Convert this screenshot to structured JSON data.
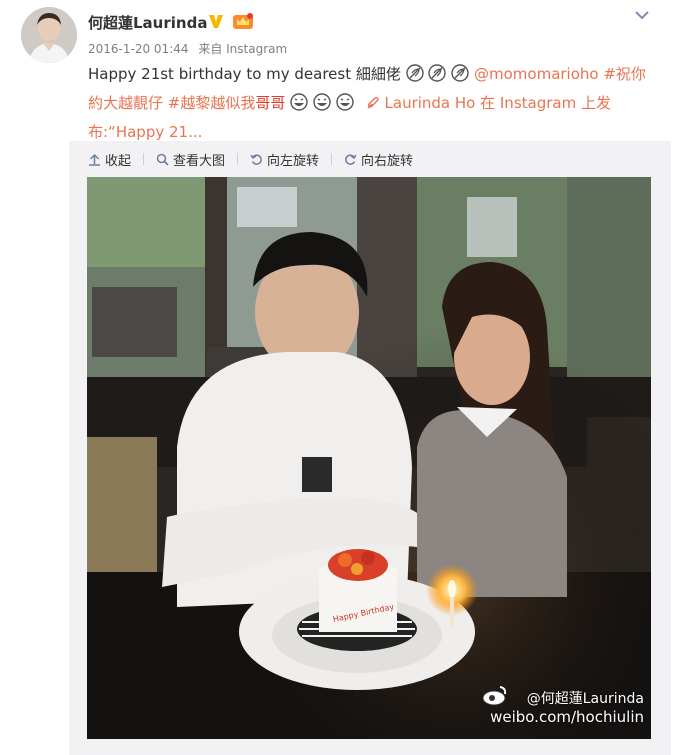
{
  "post": {
    "author": "何超蓮Laurinda",
    "timestamp": "2016-1-20 01:44",
    "source": "来自 Instagram",
    "text": {
      "intro": "Happy 21st birthday to my dearest 細細佬",
      "mention": "@momomarioho",
      "hashtag1": "#祝你約大越靚仔",
      "hashtag2": "#越黎越似我",
      "red_word": "哥哥",
      "link_label": "Laurinda Ho 在 Instagram 上发布:“Happy 21..."
    }
  },
  "toolbar": {
    "collapse": "收起",
    "view_large": "查看大图",
    "rotate_left": "向左旋转",
    "rotate_right": "向右旋转"
  },
  "photo": {
    "watermark_handle": "@何超蓮Laurinda",
    "watermark_url": "weibo.com/hochiulin"
  },
  "colors": {
    "link": "#eb7350",
    "hashtag_red": "#e53b2c",
    "muted": "#808080",
    "toolbar_bg": "#f2f2f5",
    "verified_gold": "#f7b500"
  }
}
